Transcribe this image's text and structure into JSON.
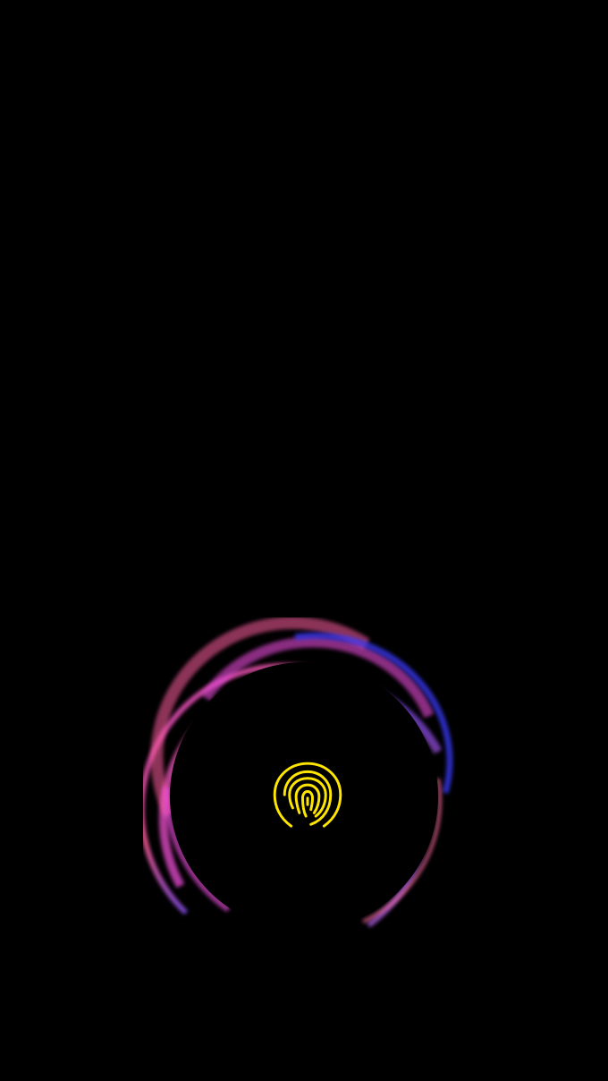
{
  "screen": {
    "background_color": "#000000",
    "type": "in-display fingerprint unlock (always-on screen)"
  },
  "fingerprint_sensor": {
    "icon": "fingerprint-icon",
    "icon_color": "#FFE600"
  },
  "glow_animation": {
    "colors": [
      "#3B3BFF",
      "#6A4CFF",
      "#FF5FA0",
      "#E64BD8",
      "#FF6F9E"
    ]
  }
}
